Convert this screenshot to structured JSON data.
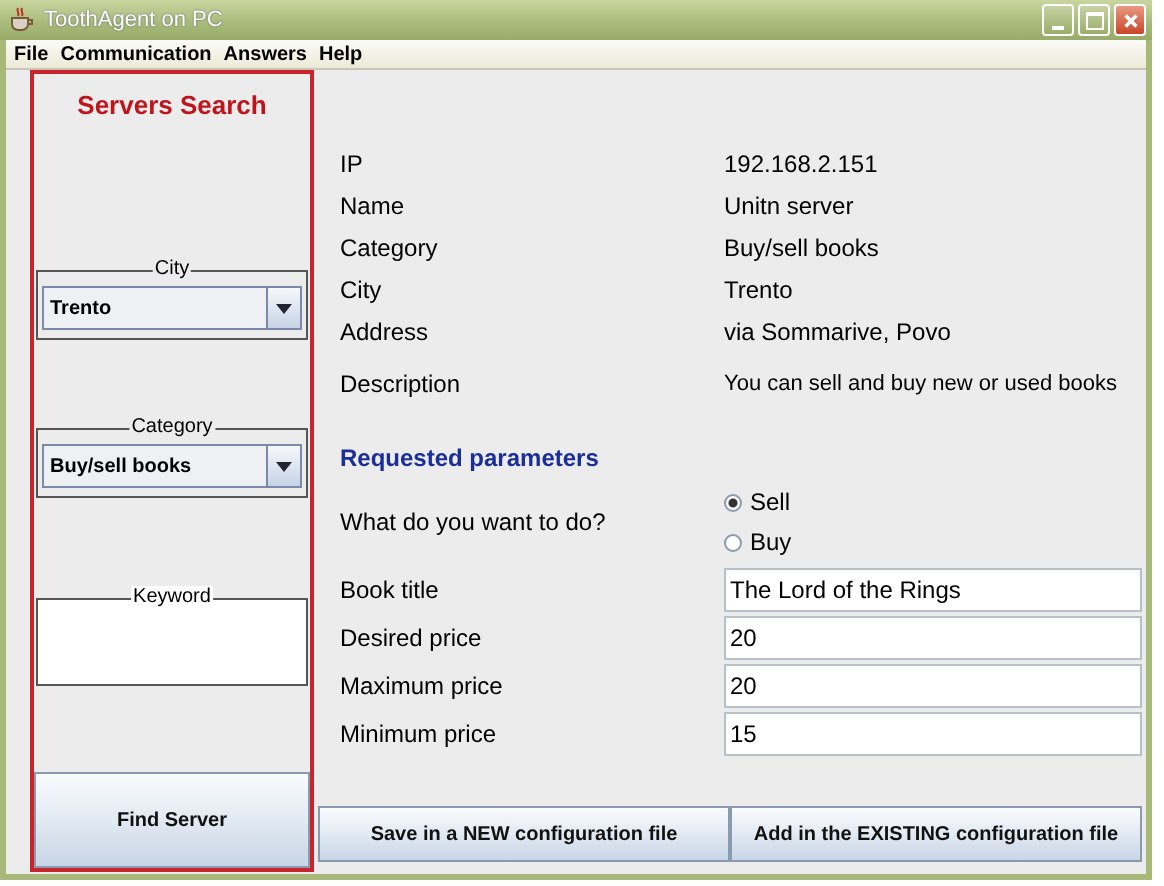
{
  "window": {
    "title": "ToothAgent on PC"
  },
  "menu": [
    "File",
    "Communication",
    "Answers",
    "Help"
  ],
  "search_panel": {
    "title": "Servers Search",
    "city": {
      "legend": "City",
      "value": "Trento"
    },
    "category": {
      "legend": "Category",
      "value": "Buy/sell books"
    },
    "keyword": {
      "legend": "Keyword"
    },
    "button": "Find Server"
  },
  "details": [
    {
      "label": "IP",
      "value": "192.168.2.151"
    },
    {
      "label": "Name",
      "value": "Unitn server"
    },
    {
      "label": "Category",
      "value": "Buy/sell books"
    },
    {
      "label": "City",
      "value": "Trento"
    },
    {
      "label": "Address",
      "value": "via Sommarive, Povo"
    },
    {
      "label": "Description",
      "value": "You can sell and buy new or used books"
    }
  ],
  "requested": {
    "title": "Requested parameters",
    "question": "What do you want to do?",
    "options": [
      {
        "label": "Sell",
        "selected": true
      },
      {
        "label": "Buy",
        "selected": false
      }
    ],
    "fields": [
      {
        "label": "Book title",
        "value": "The Lord of the Rings"
      },
      {
        "label": "Desired price",
        "value": "20"
      },
      {
        "label": "Maximum price",
        "value": "20"
      },
      {
        "label": "Minimum price",
        "value": "15"
      }
    ]
  },
  "buttons": [
    "Save in a NEW configuration file",
    "Add in the EXISTING configuration file"
  ]
}
